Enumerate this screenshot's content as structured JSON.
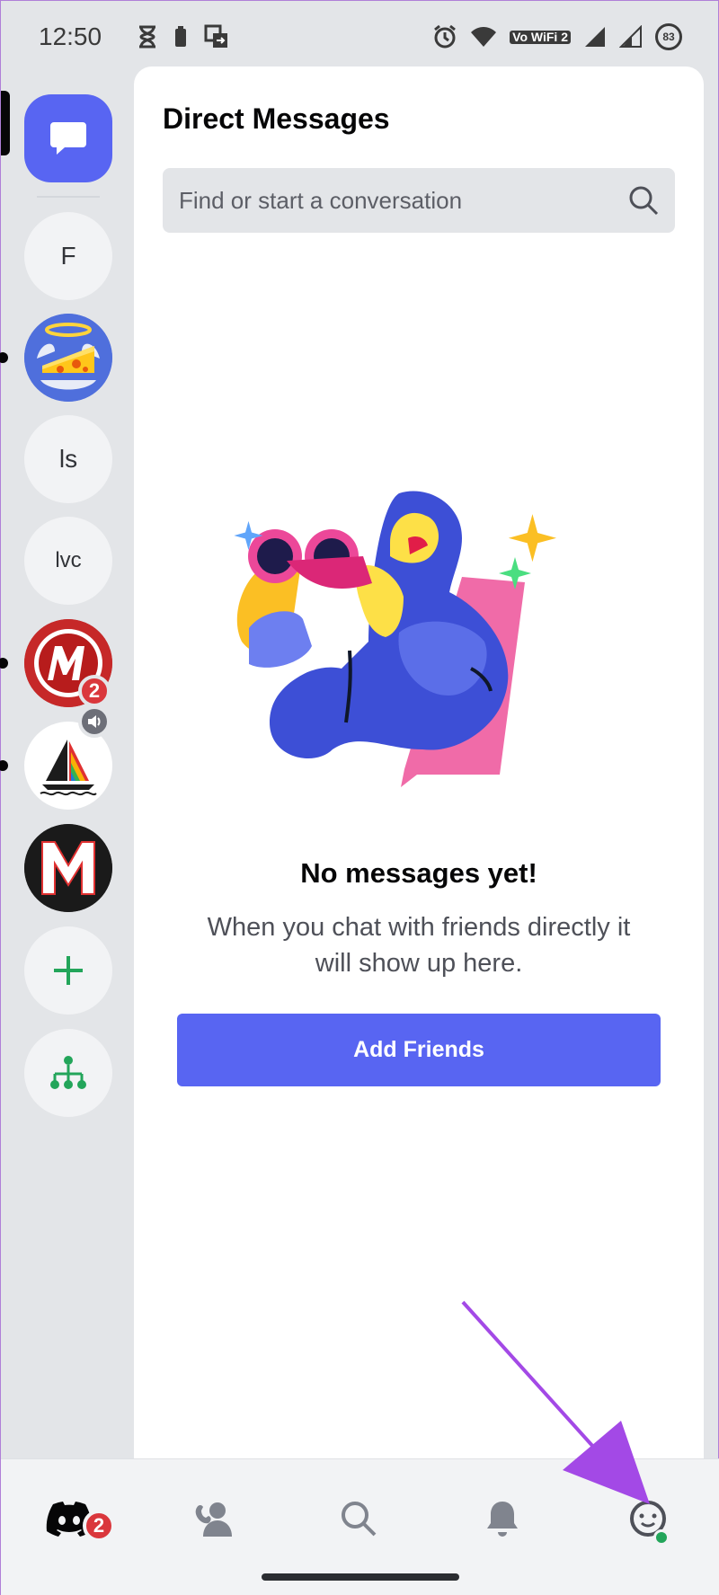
{
  "status_bar": {
    "time": "12:50",
    "battery_level": "83",
    "network_label": "Vo WiFi 2"
  },
  "server_rail": {
    "items": [
      {
        "kind": "direct-messages",
        "icon": "chat-bubble-icon"
      },
      {
        "kind": "server",
        "label": "F"
      },
      {
        "kind": "server",
        "icon": "cheese-angel-avatar"
      },
      {
        "kind": "server",
        "label": "ls"
      },
      {
        "kind": "server",
        "label": "lvc"
      },
      {
        "kind": "server",
        "icon": "m-logo-red",
        "badge": "2"
      },
      {
        "kind": "server",
        "icon": "sailboat-logo"
      },
      {
        "kind": "server",
        "icon": "m-logo-black"
      },
      {
        "kind": "action",
        "icon": "plus-icon"
      },
      {
        "kind": "action",
        "icon": "hub-icon"
      }
    ]
  },
  "main": {
    "title": "Direct Messages",
    "search_placeholder": "Find or start a conversation",
    "empty_title": "No messages yet!",
    "empty_line1": "When you chat with friends directly it",
    "empty_line2": "will show up here.",
    "add_friends_label": "Add Friends"
  },
  "tab_bar": {
    "home_badge": "2",
    "tabs": [
      "home",
      "friends",
      "search",
      "notifications",
      "profile"
    ]
  },
  "colors": {
    "blurple": "#5865f2",
    "badge_red": "#da373c",
    "online_green": "#23a55a",
    "annotation_arrow": "#a349e6"
  }
}
